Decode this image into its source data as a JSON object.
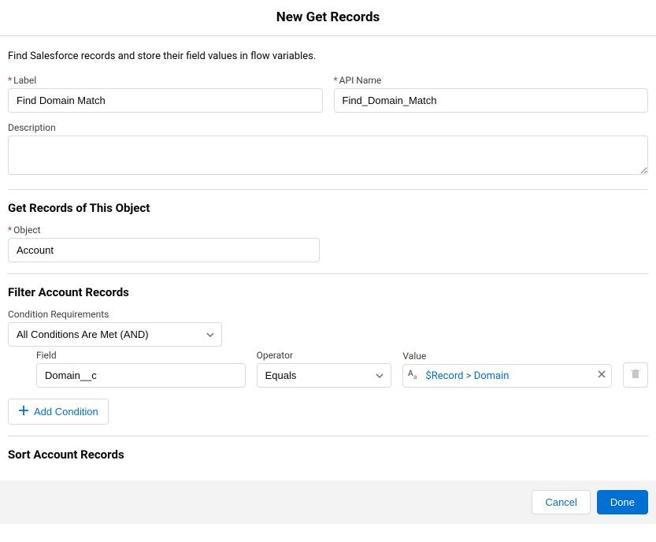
{
  "header": {
    "title": "New Get Records"
  },
  "intro": "Find Salesforce records and store their field values in flow variables.",
  "fields": {
    "label_label": "Label",
    "label_value": "Find Domain Match",
    "api_label": "API Name",
    "api_value": "Find_Domain_Match",
    "description_label": "Description",
    "description_value": ""
  },
  "sections": {
    "get_records_title": "Get Records of This Object",
    "object_label": "Object",
    "object_value": "Account",
    "filter_title": "Filter Account Records",
    "condition_req_label": "Condition Requirements",
    "condition_req_value": "All Conditions Are Met (AND)",
    "sort_title": "Sort Account Records"
  },
  "filter": {
    "field_label": "Field",
    "field_value": "Domain__c",
    "op_label": "Operator",
    "op_value": "Equals",
    "value_label": "Value",
    "value_pill": "$Record > Domain",
    "add_condition": "Add Condition"
  },
  "footer": {
    "cancel": "Cancel",
    "done": "Done"
  }
}
